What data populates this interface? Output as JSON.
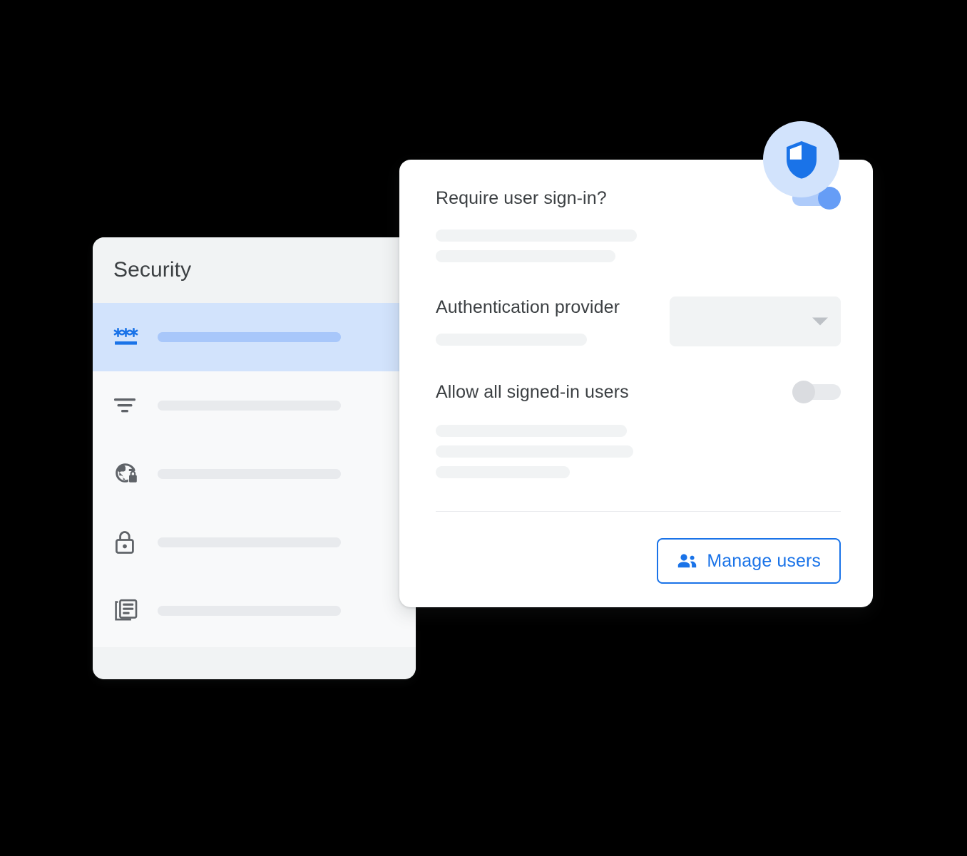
{
  "background_color": "#000000",
  "accent_color": "#1a73e8",
  "nav_panel": {
    "title": "Security",
    "items": [
      {
        "icon": "password-icon",
        "selected": true,
        "label": ""
      },
      {
        "icon": "filter-icon",
        "selected": false,
        "label": ""
      },
      {
        "icon": "globe-lock-icon",
        "selected": false,
        "label": ""
      },
      {
        "icon": "padlock-icon",
        "selected": false,
        "label": ""
      },
      {
        "icon": "article-stack-icon",
        "selected": false,
        "label": ""
      }
    ]
  },
  "badge": {
    "icon": "shield-icon",
    "circle_color": "#d2e3fc",
    "shield_color": "#1a73e8"
  },
  "settings_panel": {
    "fields": [
      {
        "label": "Require user sign-in?",
        "control": "toggle",
        "toggle_state": "on",
        "placeholder_bars": [
          282,
          252
        ]
      },
      {
        "label": "Authentication provider",
        "control": "select",
        "select_value": "",
        "placeholder_bars": [
          212
        ]
      },
      {
        "label": "Allow all signed-in users",
        "control": "toggle",
        "toggle_state": "off",
        "placeholder_bars": [
          268,
          277,
          188
        ]
      }
    ],
    "action": {
      "label": "Manage users",
      "icon": "people-icon",
      "style": "outlined"
    }
  }
}
